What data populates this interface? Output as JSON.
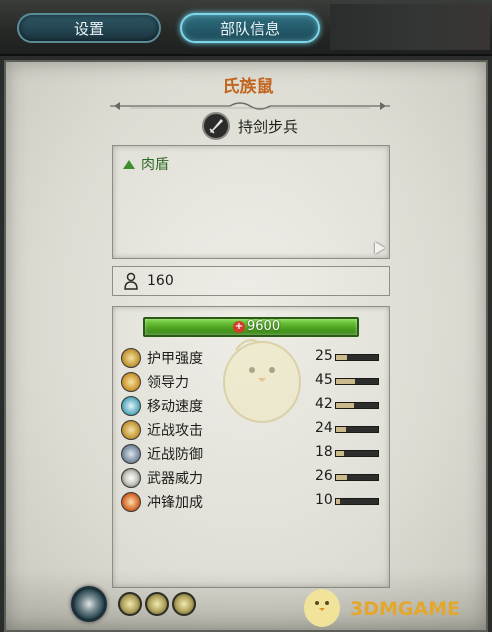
{
  "tabs": {
    "settings_label": "设置",
    "unit_info_label": "部队信息",
    "active": "unit_info"
  },
  "unit": {
    "name": "氏族鼠",
    "type_icon": "sword-icon",
    "type_label": "持剑步兵",
    "abilities": [
      {
        "label": "肉盾",
        "icon": "up-triangle-icon"
      }
    ],
    "men_count": "160",
    "hit_points": "9600",
    "stats": [
      {
        "label": "护甲强度",
        "value": "25",
        "icon": "armor-icon",
        "fill": 0.25
      },
      {
        "label": "领导力",
        "value": "45",
        "icon": "leadership-icon",
        "fill": 0.45
      },
      {
        "label": "移动速度",
        "value": "42",
        "icon": "speed-icon",
        "fill": 0.42
      },
      {
        "label": "近战攻击",
        "value": "24",
        "icon": "melee-attack-icon",
        "fill": 0.24
      },
      {
        "label": "近战防御",
        "value": "18",
        "icon": "melee-defence-icon",
        "fill": 0.18
      },
      {
        "label": "武器威力",
        "value": "26",
        "icon": "weapon-strength-icon",
        "fill": 0.26
      },
      {
        "label": "冲锋加成",
        "value": "10",
        "icon": "charge-bonus-icon",
        "fill": 0.1
      }
    ]
  },
  "bottom_icons": [
    "faction-emblem-icon",
    "eye-icon",
    "attribute-icon",
    "attribute-icon"
  ],
  "watermark": "3DMGAME",
  "colors": {
    "faction_name": "#c2651f",
    "ability_text": "#2d6b22",
    "hp_bar": "#4ea423",
    "tab_active_glow": "#7ed6e8"
  }
}
